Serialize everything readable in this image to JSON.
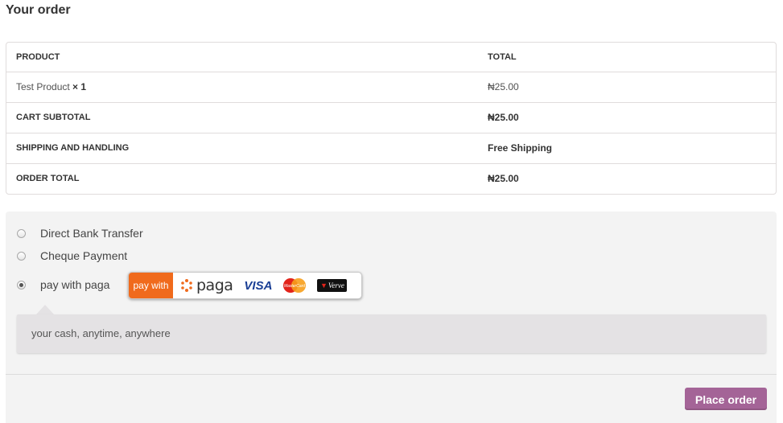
{
  "title": "Your order",
  "table": {
    "header": {
      "product": "PRODUCT",
      "total": "TOTAL"
    },
    "item": {
      "name": "Test Product",
      "qty": "× 1",
      "total": "₦25.00"
    },
    "subtotal": {
      "label": "CART SUBTOTAL",
      "value": "₦25.00"
    },
    "shipping": {
      "label": "SHIPPING AND HANDLING",
      "value": "Free Shipping"
    },
    "order_total": {
      "label": "ORDER TOTAL",
      "value": "₦25.00"
    }
  },
  "payment": {
    "methods": [
      {
        "label": "Direct Bank Transfer",
        "checked": false
      },
      {
        "label": "Cheque Payment",
        "checked": false
      },
      {
        "label": "pay with paga",
        "checked": true
      }
    ],
    "badge": {
      "paywith": "pay with",
      "paga": "paga",
      "visa": "VISA",
      "mastercard": "MasterCard",
      "verve": "Verve"
    },
    "description": "your cash, anytime, anywhere"
  },
  "place_order": "Place order",
  "colors": {
    "accent": "#a46497",
    "paga_orange": "#f06a1c",
    "panel_bg": "#f3f3f3"
  }
}
